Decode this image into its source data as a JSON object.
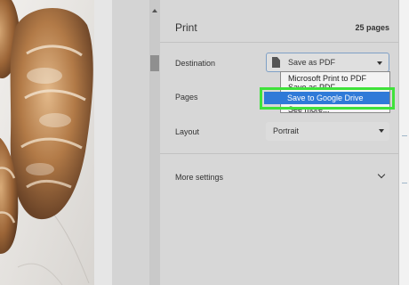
{
  "print_dialog": {
    "title": "Print",
    "page_count": "25 pages",
    "destination": {
      "label": "Destination",
      "value": "Save as PDF",
      "options": [
        "Microsoft Print to PDF",
        "Save as PDF",
        "Save to Google Drive",
        "See more..."
      ],
      "highlighted_option": "Save to Google Drive"
    },
    "pages": {
      "label": "Pages"
    },
    "layout": {
      "label": "Layout",
      "value": "Portrait"
    },
    "more_settings": {
      "label": "More settings"
    }
  },
  "colors": {
    "highlight_border": "#3fe23a",
    "selected_option": "#2f7ad8",
    "panel_background": "#d7d7d7"
  },
  "icons": {
    "destination": "document-icon",
    "dropdown": "caret-down-icon",
    "expand": "chevron-down-icon"
  }
}
